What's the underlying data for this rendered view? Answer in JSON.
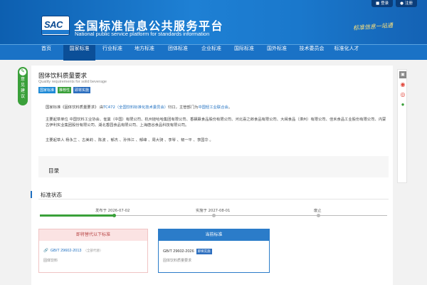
{
  "header": {
    "logo_text": "SAC",
    "title": "全国标准信息公共服务平台",
    "subtitle": "National public service platform  for standards information",
    "slogan": "标准信息一站通",
    "login_label": "登录",
    "register_label": "注册"
  },
  "nav": {
    "items": [
      "首页",
      "国家标准",
      "行业标准",
      "地方标准",
      "团体标准",
      "企业标准",
      "国际标准",
      "国外标准",
      "技术委员会",
      "标准化人才"
    ],
    "active_index": 1
  },
  "feedback": {
    "label": "意见建议"
  },
  "standard": {
    "title": "固体饮料质量要求",
    "english_title": "Quality requirements for solid beverage",
    "badges": [
      "国家标准",
      "推荐性",
      "即将实施"
    ],
    "para1_a": "国家标准《固体饮料质量要求》 由",
    "para1_link1": "TC472（全国饮料标准化技术委员会）",
    "para1_b": "归口，主管部门为",
    "para1_link2": "中国轻工业联合会",
    "para1_c": "。",
    "para2": "主要起草单位 中国饮料工业协会、雀巢（中国）有限公司、杭州娃哈哈集团有限公司、香飘飘食品股份有限公司、河北喜之郎食品有限公司、大闽食品（漳州）有限公司、佳禾食品工业股份有限公司、内蒙古伊利实业集团股份有限公司、湖北香园食品有限公司、上海唐谷食品科技有限公司。",
    "para3": "主要起草人 杨永兰 、古美莉 、陈波 、郁杰 、孙伟江 、郁峰 、周大骑 、李琴 、韧一平 、李国华 。",
    "toc_title": "目录"
  },
  "status": {
    "title": "标准状态",
    "published": "发布于 2026-07-02",
    "implemented": "实施于 2027-08-01",
    "abolished": "废止"
  },
  "replaced_card": {
    "head": "即将替代以下标准",
    "code": "GB/T 29602-2013",
    "tag": "（全部代替）",
    "name": "固体饮料"
  },
  "current_card": {
    "head": "当前标准",
    "code": "GB/T 29602-2026",
    "tag": "即将实施",
    "name": "固体饮料质量要求"
  },
  "colors": {
    "primary": "#1a72c6",
    "green": "#3aa03a",
    "badge_blue": "#1e8ad6",
    "red_soft": "#fbe3e3"
  }
}
